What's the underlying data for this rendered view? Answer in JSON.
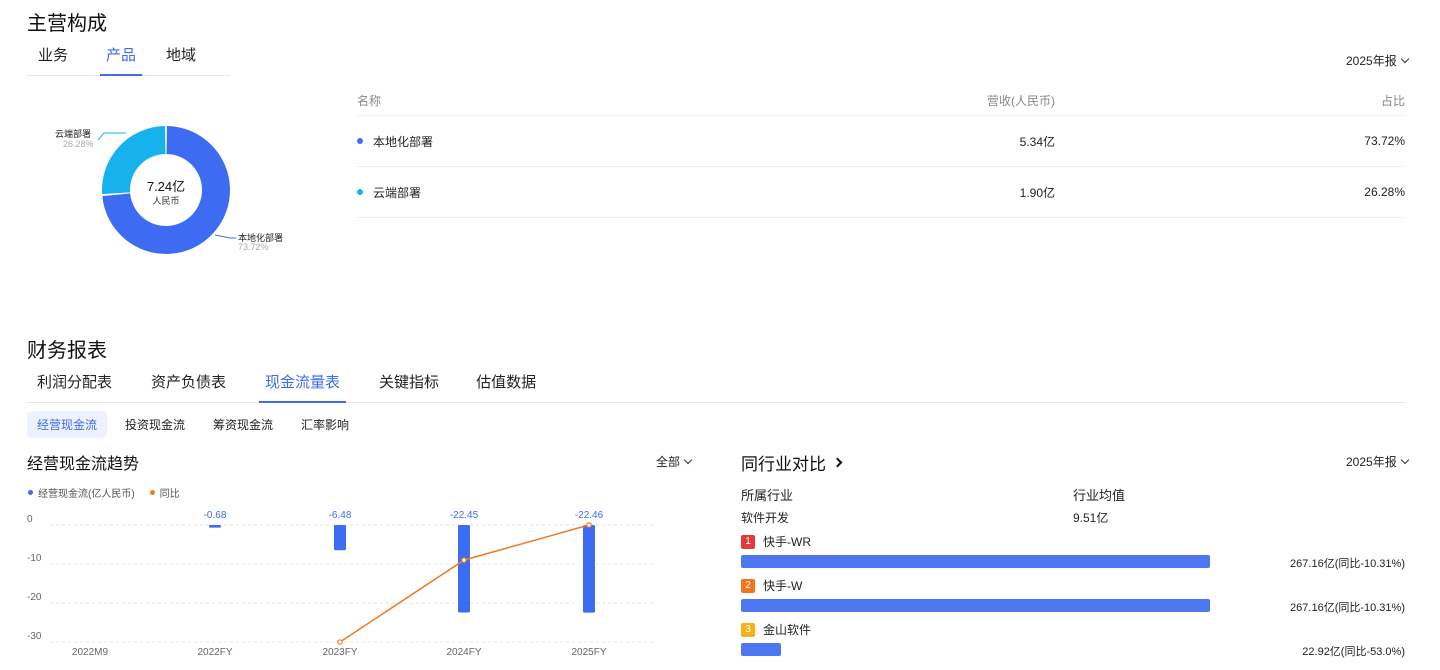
{
  "composition": {
    "title": "主营构成",
    "tabs": [
      {
        "label": "业务",
        "active": false
      },
      {
        "label": "产品",
        "active": true
      },
      {
        "label": "地域",
        "active": false
      }
    ],
    "period": "2025年报",
    "donut": {
      "center_value": "7.24亿",
      "center_unit": "人民币",
      "slices": [
        {
          "name": "本地化部署",
          "pct": "73.72%",
          "value": 73.72,
          "color": "#3d6cf2"
        },
        {
          "name": "云端部署",
          "pct": "26.28%",
          "value": 26.28,
          "color": "#16b2ee"
        }
      ]
    },
    "table": {
      "headers": [
        "名称",
        "营收(人民币)",
        "占比"
      ],
      "rows": [
        {
          "name": "本地化部署",
          "revenue": "5.34亿",
          "pct": "73.72%",
          "color": "#3d6cf2"
        },
        {
          "name": "云端部署",
          "revenue": "1.90亿",
          "pct": "26.28%",
          "color": "#16b2ee"
        }
      ]
    }
  },
  "financials": {
    "title": "财务报表",
    "tabs": [
      {
        "label": "利润分配表",
        "active": false
      },
      {
        "label": "资产负债表",
        "active": false
      },
      {
        "label": "现金流量表",
        "active": true
      },
      {
        "label": "关键指标",
        "active": false
      },
      {
        "label": "估值数据",
        "active": false
      }
    ],
    "subtabs": [
      {
        "label": "经营现金流",
        "active": true
      },
      {
        "label": "投资现金流",
        "active": false
      },
      {
        "label": "筹资现金流",
        "active": false
      },
      {
        "label": "汇率影响",
        "active": false
      }
    ]
  },
  "trend": {
    "title": "经营现金流趋势",
    "filter": "全部",
    "legend": [
      "经营现金流(亿人民币)",
      "同比"
    ],
    "colors": {
      "bar": "#3d6cf2",
      "line": "#f07b22"
    }
  },
  "chart_data": {
    "type": "bar",
    "title": "经营现金流趋势",
    "categories": [
      "2022M9",
      "2022FY",
      "2023FY",
      "2024FY",
      "2025FY"
    ],
    "yticks": [
      "0",
      "-10",
      "-20",
      "-30"
    ],
    "ylim": [
      -30,
      0
    ],
    "series": [
      {
        "name": "经营现金流(亿人民币)",
        "type": "bar",
        "values": [
          null,
          -0.68,
          -6.48,
          -22.45,
          -22.46
        ],
        "labels": [
          "",
          "-0.68",
          "-6.48",
          "-22.45",
          "-22.46"
        ]
      },
      {
        "name": "同比",
        "type": "line",
        "values": [
          null,
          null,
          -30,
          -9,
          0
        ]
      }
    ],
    "legend_position": "top-left",
    "grid": true
  },
  "peer": {
    "title": "同行业对比",
    "period": "2025年报",
    "industry_label": "所属行业",
    "industry_value": "软件开发",
    "avg_label": "行业均值",
    "avg_value": "9.51亿",
    "companies": [
      {
        "rank": "1",
        "name": "快手-WR",
        "amount": "267.16亿(同比-10.31%)",
        "ratio": 1.0,
        "rank_color": "#e23b3b"
      },
      {
        "rank": "2",
        "name": "快手-W",
        "amount": "267.16亿(同比-10.31%)",
        "ratio": 1.0,
        "rank_color": "#f4741f"
      },
      {
        "rank": "3",
        "name": "金山软件",
        "amount": "22.92亿(同比-53.0%)",
        "ratio": 0.0858,
        "rank_color": "#f5b21b"
      }
    ]
  }
}
